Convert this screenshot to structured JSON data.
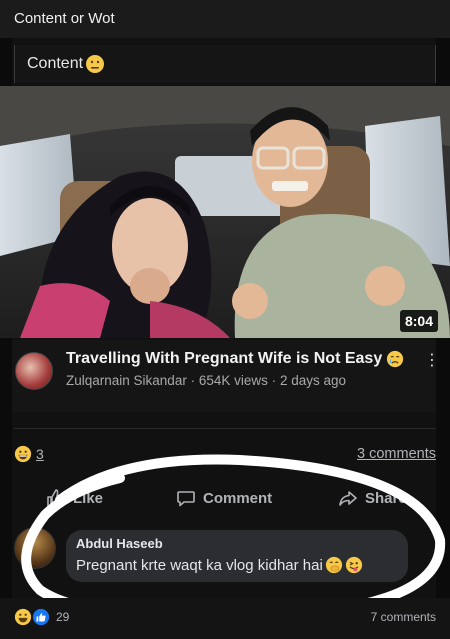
{
  "topbar": {
    "title": "Content or Wot"
  },
  "post": {
    "text": "Content",
    "emoji_icon": "neutral-face-icon"
  },
  "video": {
    "duration": "8:04",
    "title": "Travelling With Pregnant Wife is Not Easy",
    "title_emoji_icon": "crying-face-icon",
    "channel": "Zulqarnain Sikandar",
    "views": "654K views",
    "age": "2 days ago",
    "separator": "·"
  },
  "reactions": {
    "count": "3",
    "comments_link": "3 comments"
  },
  "actions": {
    "like_label": "Like",
    "comment_label": "Comment",
    "share_label": "Share"
  },
  "comment": {
    "author": "Abdul Haseeb",
    "text": "Pregnant krte waqt ka vlog kidhar hai"
  },
  "footer": {
    "reaction_count": "29",
    "comments": "7 comments"
  },
  "colors": {
    "background": "#0b0b0b",
    "bubble": "#2b2d30",
    "muted_text": "#b0b3b8",
    "emoji_yellow": "#f7c948",
    "like_blue": "#1877f2"
  }
}
